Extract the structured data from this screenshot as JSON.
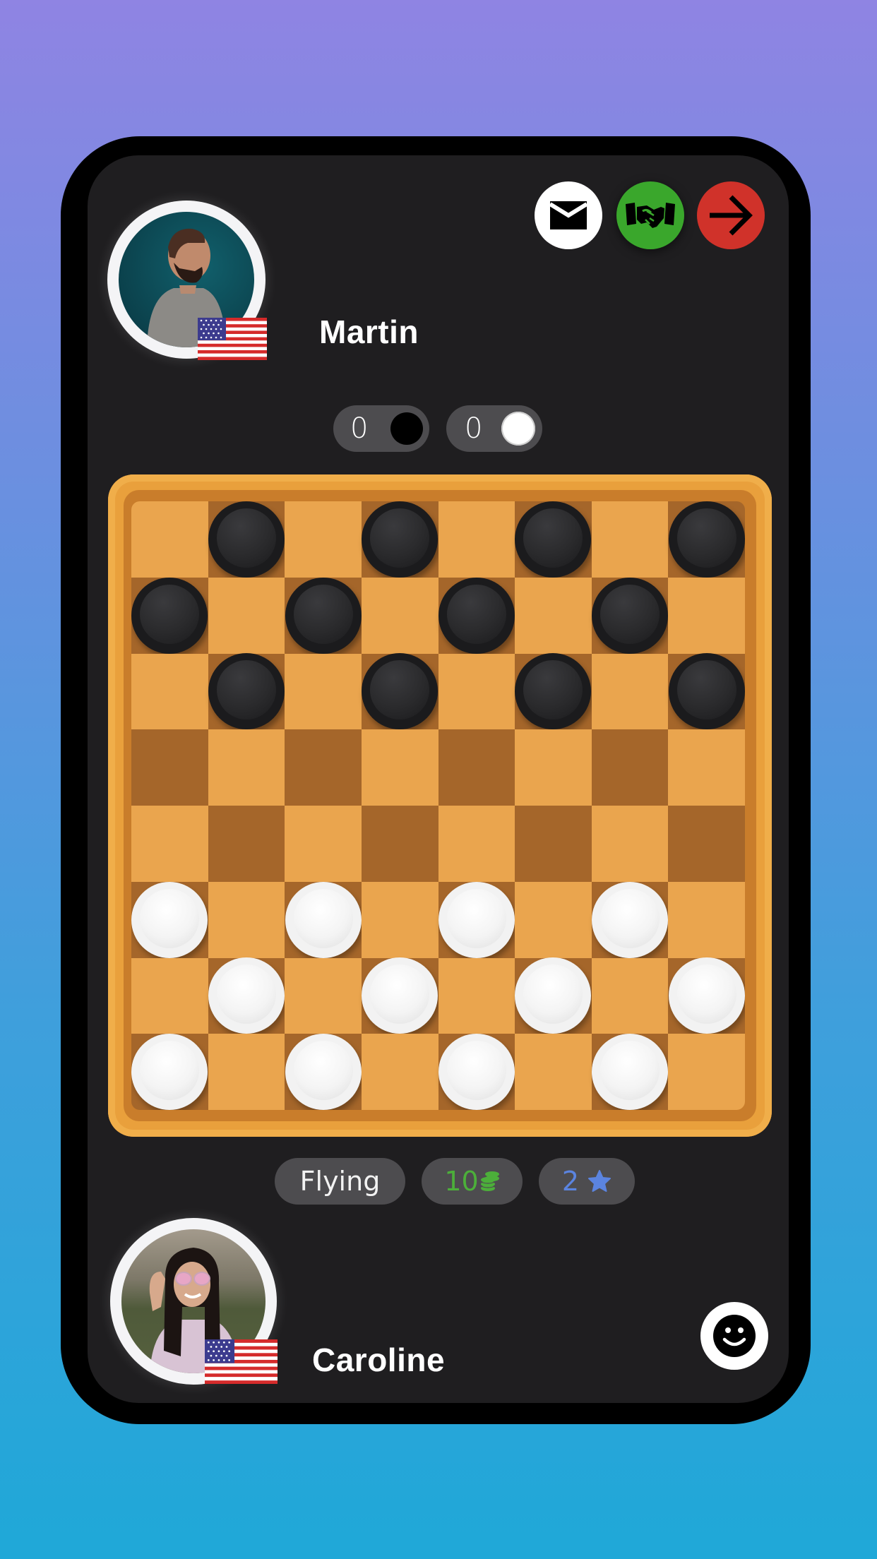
{
  "header": {
    "buttons": [
      {
        "name": "message-button",
        "icon": "envelope-icon",
        "color": "#ffffff"
      },
      {
        "name": "offer-draw-button",
        "icon": "handshake-icon",
        "color": "#3aa72c"
      },
      {
        "name": "leave-game-button",
        "icon": "arrow-right-icon",
        "color": "#d0322a"
      }
    ]
  },
  "players": {
    "opponent": {
      "name": "Martin",
      "country_flag": "us-flag-icon"
    },
    "self": {
      "name": "Caroline",
      "country_flag": "us-flag-icon"
    }
  },
  "scores": {
    "black": {
      "value": "0",
      "piece": "black"
    },
    "white": {
      "value": "0",
      "piece": "white"
    }
  },
  "board": {
    "size": 8,
    "colors": {
      "light": "#eaa54e",
      "dark": "#a5662a",
      "frame": "#e9a03c"
    },
    "rows": [
      ". b . b . b . b",
      "b . b . b . b .",
      ". b . b . b . b",
      ". . . . . . . .",
      ". . . . . . . .",
      "w . w . w . w .",
      ". w . w . w . w",
      "w . w . w . w ."
    ]
  },
  "game_info": {
    "mode": "Flying",
    "bet": "10",
    "bet_icon": "coins-icon",
    "bet_color": "#4caf3a",
    "rating": "2",
    "rating_icon": "star-icon",
    "rating_color": "#5b84e0"
  },
  "emoji_button": {
    "icon": "smiley-icon"
  }
}
